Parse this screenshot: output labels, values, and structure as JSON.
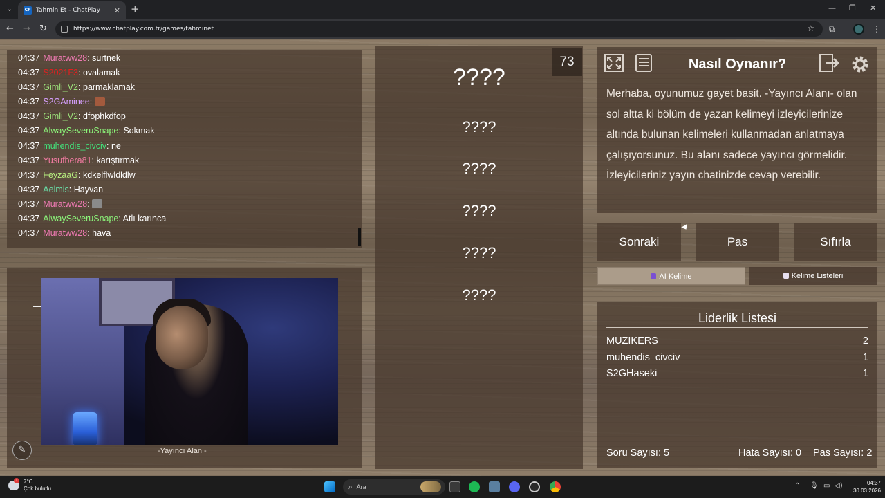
{
  "browser": {
    "tab_title": "Tahmin Et - ChatPlay",
    "tab_favicon": "CP",
    "url": "https://www.chatplay.com.tr/games/tahminet"
  },
  "chat": {
    "messages": [
      {
        "time": "04:37",
        "user": "Muratww28",
        "user_color": "#f07ab4",
        "text": "surtnek"
      },
      {
        "time": "04:37",
        "user": "S2021F3",
        "user_color": "#e02020",
        "text": "ovalamak"
      },
      {
        "time": "04:37",
        "user": "Gimli_V2",
        "user_color": "#9be07a",
        "text": "parmaklamak"
      },
      {
        "time": "04:37",
        "user": "S2GAminee",
        "user_color": "#d7a0ff",
        "text": "",
        "emote": "#a35a3d"
      },
      {
        "time": "04:37",
        "user": "Gimli_V2",
        "user_color": "#9be07a",
        "text": "dfophkdfop"
      },
      {
        "time": "04:37",
        "user": "AlwaySeveruSnape",
        "user_color": "#8cf57a",
        "text": "Sokmak"
      },
      {
        "time": "04:37",
        "user": "muhendis_civciv",
        "user_color": "#43e07a",
        "text": "ne"
      },
      {
        "time": "04:37",
        "user": "Yusufbera81",
        "user_color": "#f07aa0",
        "text": "karıştırmak"
      },
      {
        "time": "04:37",
        "user": "FeyzaaG",
        "user_color": "#b8f080",
        "text": "kdkelflwldldlw"
      },
      {
        "time": "04:37",
        "user": "Aelmis",
        "user_color": "#6ae0a8",
        "text": "Hayvan"
      },
      {
        "time": "04:37",
        "user": "Muratww28",
        "user_color": "#f07ab4",
        "text": "",
        "emote": "#8a8a8a"
      },
      {
        "time": "04:37",
        "user": "AlwaySeveruSnape",
        "user_color": "#8cf57a",
        "text": "Atlı karınca"
      },
      {
        "time": "04:37",
        "user": "Muratww28",
        "user_color": "#f07ab4",
        "text": "hava"
      }
    ]
  },
  "streamer": {
    "label": "-Yayıncı Alanı-",
    "pen_icon": "pencil-icon"
  },
  "words": {
    "round_number": "73",
    "main": "????",
    "forbidden": [
      "????",
      "????",
      "????",
      "????",
      "????"
    ]
  },
  "howto": {
    "title": "Nasıl Oynanır?",
    "body": "Merhaba, oyunumuz gayet basit. -Yayıncı Alanı- olan sol altta ki bölüm de yazan kelimeyi izleyicilerinize altında bulunan kelimeleri kullanmadan anlatmaya çalışıyorsunuz. Bu alanı sadece yayıncı görmelidir. İzleyicileriniz yayın chatinizde cevap verebilir."
  },
  "actions": {
    "next": "Sonraki",
    "pass": "Pas",
    "reset": "Sıfırla",
    "ai_word": "AI Kelime",
    "word_lists": "Kelime Listeleri"
  },
  "leaderboard": {
    "title": "Liderlik Listesi",
    "rows": [
      {
        "name": "MUZIKERS",
        "score": "2"
      },
      {
        "name": "muhendis_civciv",
        "score": "1"
      },
      {
        "name": "S2GHaseki",
        "score": "1"
      }
    ],
    "questions": "Soru Sayısı: 5",
    "errors": "Hata Sayısı: 0",
    "passes": "Pas Sayısı: 2"
  },
  "taskbar": {
    "temp": "7°C",
    "weather": "Çok bulutlu",
    "badge": "1",
    "search": "Ara",
    "time": "04:37",
    "date": "30.03.2026"
  }
}
